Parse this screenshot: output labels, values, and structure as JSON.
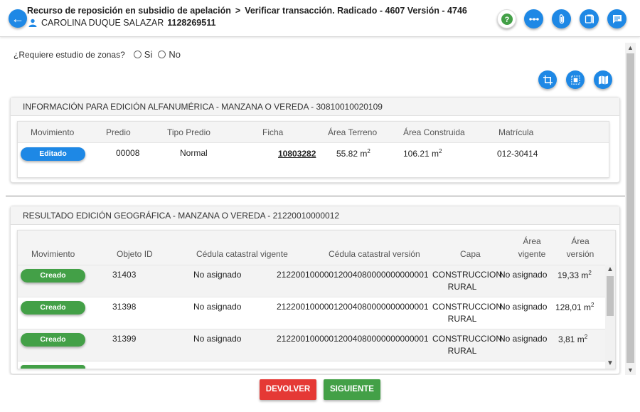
{
  "header": {
    "breadcrumb_1": "Recurso de reposición en subsidio de apelación",
    "breadcrumb_sep": ">",
    "breadcrumb_2": "Verificar transacción. Radicado - 4607 Versión - 4746",
    "user_name": "CAROLINA DUQUE SALAZAR",
    "user_id": "1128269511",
    "icons": [
      "help-icon",
      "more-icon",
      "attach-icon",
      "copy-icon",
      "comment-icon"
    ],
    "accent_color": "#1e88e5",
    "help_color": "#43a047"
  },
  "zones": {
    "question": "¿Requiere estudio de zonas?",
    "option_yes": "Si",
    "option_no": "No"
  },
  "tools": [
    "crop-icon",
    "select-icon",
    "map-icon"
  ],
  "alfanumerica": {
    "title": "INFORMACIÓN PARA EDICIÓN ALFANUMÉRICA - MANZANA O VEREDA - 30810010020109",
    "columns": [
      "Movimiento",
      "Predio",
      "Tipo Predio",
      "Ficha",
      "Área Terreno",
      "Área Construida",
      "Matrícula"
    ],
    "row": {
      "movimiento": "Editado",
      "predio": "00008",
      "tipo": "Normal",
      "ficha": "10803282",
      "area_terreno": "55.82 m",
      "area_construida": "106.21 m",
      "sup": "2",
      "matricula": "012-30414"
    }
  },
  "geografica": {
    "title": "RESULTADO EDICIÓN GEOGRÁFICA - MANZANA O VEREDA - 21220010000012",
    "columns": {
      "movimiento": "Movimiento",
      "objeto": "Objeto ID",
      "cedula_vigente": "Cédula catastral vigente",
      "cedula_version": "Cédula catastral versión",
      "capa": "Capa",
      "area_vigente_1": "Área",
      "area_vigente_2": "vigente",
      "area_version_1": "Área",
      "area_version_2": "versión"
    },
    "rows": [
      {
        "movimiento": "Creado",
        "objeto": "31403",
        "vigente": "No asignado",
        "version": "21220010000012004080000000000001",
        "capa_1": "CONSTRUCCION",
        "capa_2": "RURAL",
        "area_vigente": "No asignado",
        "area_version": "19,33 m",
        "sup": "2"
      },
      {
        "movimiento": "Creado",
        "objeto": "31398",
        "vigente": "No asignado",
        "version": "21220010000012004080000000000001",
        "capa_1": "CONSTRUCCION",
        "capa_2": "RURAL",
        "area_vigente": "No asignado",
        "area_version": "128,01 m",
        "sup": "2"
      },
      {
        "movimiento": "Creado",
        "objeto": "31399",
        "vigente": "No asignado",
        "version": "21220010000012004080000000000001",
        "capa_1": "CONSTRUCCION",
        "capa_2": "RURAL",
        "area_vigente": "No asignado",
        "area_version": "3,81 m",
        "sup": "2"
      }
    ]
  },
  "footer": {
    "return_label": "DEVOLVER",
    "next_label": "SIGUIENTE",
    "return_color": "#e53935",
    "next_color": "#43a047"
  }
}
